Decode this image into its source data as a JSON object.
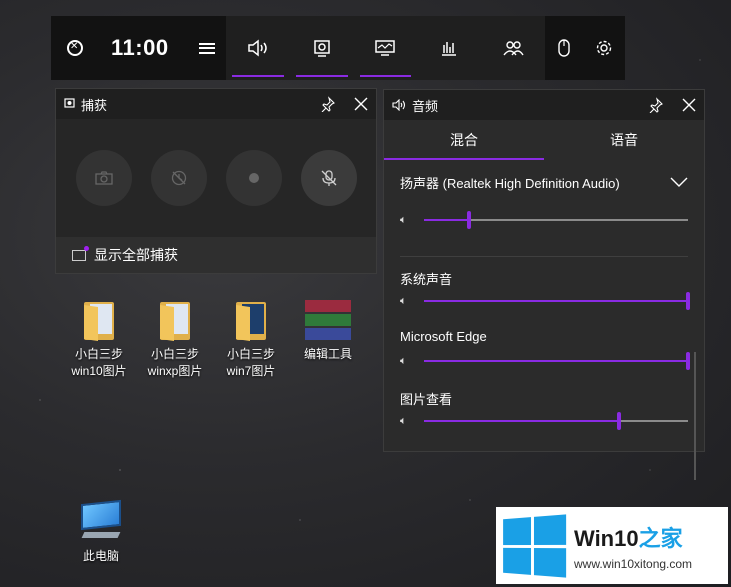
{
  "gamebar": {
    "time": "11:00",
    "tabs": [
      {
        "icon": "speaker-icon",
        "active": true
      },
      {
        "icon": "capture-icon",
        "active": true
      },
      {
        "icon": "performance-icon",
        "active": true
      },
      {
        "icon": "chart-icon",
        "active": false
      },
      {
        "icon": "social-icon",
        "active": false
      }
    ]
  },
  "capture": {
    "title": "捕获",
    "show_all": "显示全部捕获"
  },
  "audio": {
    "title": "音频",
    "tabs": [
      "混合",
      "语音"
    ],
    "device": "扬声器 (Realtek High Definition Audio)",
    "device_volume": 0.17,
    "apps": [
      {
        "name": "系统声音",
        "volume": 1.0
      },
      {
        "name": "Microsoft Edge",
        "volume": 1.0
      },
      {
        "name": "图片查看",
        "volume": 0.74
      }
    ]
  },
  "desktop": {
    "icons": [
      {
        "label1": "小白三步",
        "label2": "win10图片"
      },
      {
        "label1": "小白三步",
        "label2": "winxp图片"
      },
      {
        "label1": "小白三步",
        "label2": "win7图片"
      },
      {
        "label1": "编辑工具",
        "label2": ""
      },
      {
        "label1": "此电脑",
        "label2": ""
      }
    ]
  },
  "watermark": {
    "title": "Win10",
    "title_cn": "之家",
    "url": "www.win10xitong.com"
  },
  "colors": {
    "accent": "#8a2be2",
    "watermark_blue": "#1aa0e6"
  }
}
